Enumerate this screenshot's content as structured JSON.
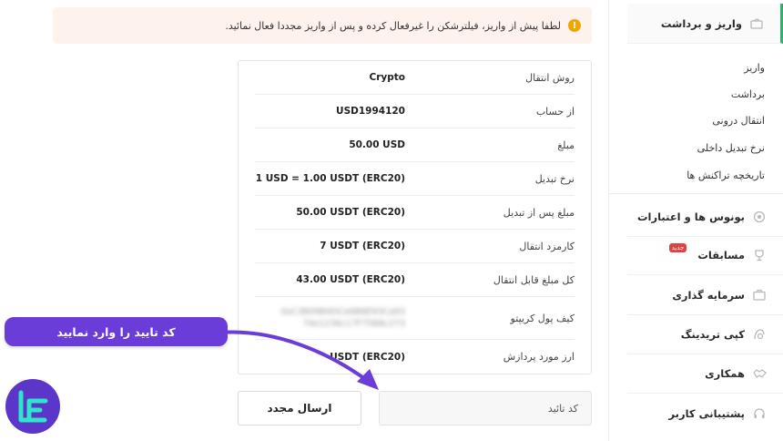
{
  "sidebar": {
    "active_section": {
      "label": "واریز و برداشت",
      "icon": "wallet-icon"
    },
    "sub_items": [
      {
        "label": "واریز"
      },
      {
        "label": "برداشت"
      },
      {
        "label": "انتقال درونی"
      },
      {
        "label": "نرخ تبدیل داخلی"
      },
      {
        "label": "تاریخچه تراکنش ها"
      }
    ],
    "sections": [
      {
        "label": "بونوس ها و اعتبارات",
        "icon": "gift-icon"
      },
      {
        "label": "مسابقات",
        "icon": "trophy-icon",
        "badge": "جدید"
      },
      {
        "label": "سرمایه گذاری",
        "icon": "briefcase-icon"
      },
      {
        "label": "کپی تریدینگ",
        "icon": "copy-trading-icon"
      },
      {
        "label": "همکاری",
        "icon": "handshake-icon"
      },
      {
        "label": "پشتیبانی کاربر",
        "icon": "headset-icon"
      }
    ]
  },
  "alert": {
    "text": "لطفا پیش از واریز، فیلترشکن را غیرفعال کرده و پس از واریز مجددا فعال نمائید.",
    "icon": "warning-icon",
    "color": "#f0a500"
  },
  "details": [
    {
      "label": "روش انتقال",
      "value": "Crypto"
    },
    {
      "label": "از حساب",
      "value": "USD1994120"
    },
    {
      "label": "مبلغ",
      "value": "50.00 USD"
    },
    {
      "label": "نرخ تبدیل",
      "value": "1 USD = 1.00 USDT (ERC20)"
    },
    {
      "label": "مبلغ پس از تبدیل",
      "value": "50.00 USDT (ERC20)"
    },
    {
      "label": "کارمزد انتقال",
      "value": "7 USDT (ERC20)"
    },
    {
      "label": "کل مبلغ قابل انتقال",
      "value": "43.00 USDT (ERC20)"
    },
    {
      "label": "کیف پول کریپتو",
      "value_line1": "0xC3B09B4DCe6B6E93Ca93",
      "value_line2": "74e1236c17F7588c273"
    },
    {
      "label": "ارز مورد پردازش",
      "value": "USDT (ERC20)"
    }
  ],
  "form": {
    "code_placeholder": "کد تائید",
    "resend_label": "ارسال مجدد"
  },
  "annotation": {
    "text": "کد تایید را وارد نمایید",
    "color": "#6a3dd8"
  },
  "colors": {
    "accent_green": "#2fb36b",
    "alert_bg": "#fdf2ec",
    "brand_purple": "#5b36c8"
  }
}
